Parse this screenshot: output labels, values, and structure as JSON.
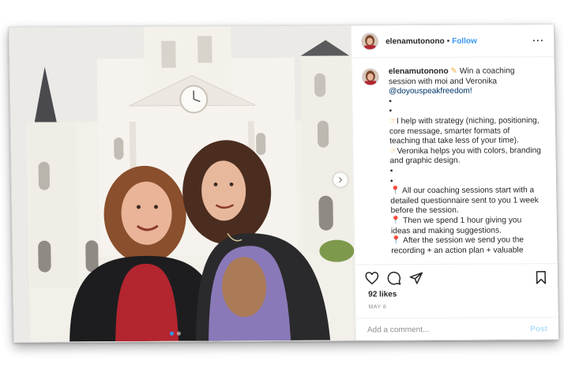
{
  "header": {
    "username": "elenamutonono",
    "separator": "•",
    "follow_label": "Follow",
    "more_label": "···"
  },
  "caption": {
    "username": "elenamutonono",
    "lines": [
      {
        "icon": "hand-emoji",
        "text": "Win a coaching session with moi and Veronika"
      },
      {
        "icon": "",
        "text": "@doyouspeakfreedom!"
      },
      {
        "icon": "",
        "text": "•"
      },
      {
        "icon": "",
        "text": "•"
      },
      {
        "icon": "hand-emoji",
        "text": "I help with strategy (niching, positioning, core message, smarter formats of teaching that take less of your time)."
      },
      {
        "icon": "hand-emoji",
        "text": "Veronika helps you with colors, branding and graphic design."
      },
      {
        "icon": "",
        "text": "•"
      },
      {
        "icon": "",
        "text": "•"
      },
      {
        "icon": "pin-emoji",
        "text": "All our coaching sessions start with a detailed questionnaire sent to you 1 week before the session."
      },
      {
        "icon": "pin-emoji",
        "text": "Then we spend 1 hour giving you ideas and making suggestions."
      },
      {
        "icon": "pin-emoji",
        "text": "After the session we send you the recording + an action plan + valuable"
      }
    ]
  },
  "actions": {
    "icons": [
      "heart-icon",
      "comment-icon",
      "share-icon",
      "bookmark-icon"
    ]
  },
  "likes": "92 likes",
  "date": "MAY 8",
  "comment": {
    "placeholder": "Add a comment...",
    "post_label": "Post"
  },
  "carousel": {
    "slide_count": 2,
    "active_index": 0,
    "next_icon": "chevron-right-icon"
  },
  "colors": {
    "accent": "#3897f0",
    "link": "#00376b",
    "post_disabled": "#b2dffc",
    "muted": "#8e8e8e"
  }
}
